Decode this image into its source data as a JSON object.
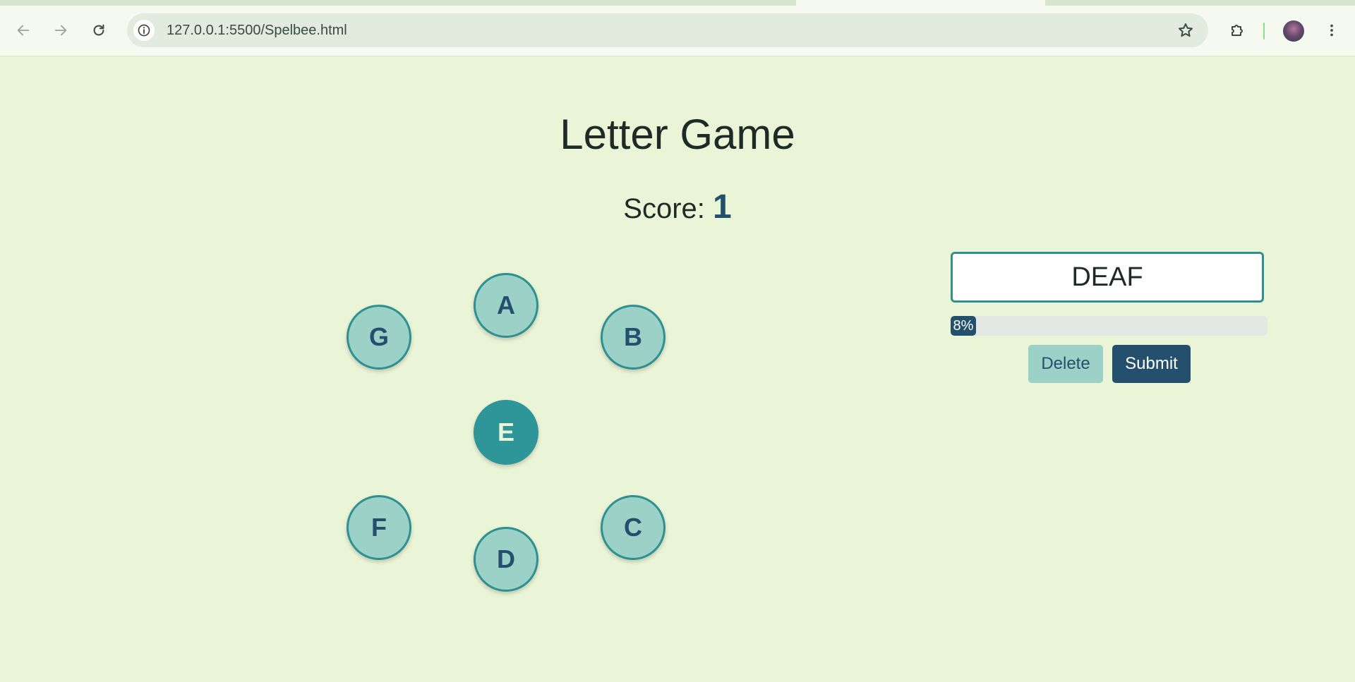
{
  "browser": {
    "url": "127.0.0.1:5500/Spelbee.html",
    "icons": {
      "back": "arrow-left-icon",
      "forward": "arrow-right-icon",
      "reload": "reload-icon",
      "site_info": "info-icon",
      "bookmark": "star-icon",
      "extensions": "puzzle-icon",
      "profile": "avatar",
      "menu": "kebab-menu-icon"
    }
  },
  "game": {
    "title": "Letter Game",
    "score_label": "Score:",
    "score_value": "1",
    "letters": {
      "top": "A",
      "upper_left": "G",
      "upper_right": "B",
      "center": "E",
      "lower_left": "F",
      "lower_right": "C",
      "bottom": "D"
    },
    "current_word": "DEAF",
    "progress_percent": 8,
    "progress_label": "8%",
    "delete_label": "Delete",
    "submit_label": "Submit"
  },
  "colors": {
    "page_background": "#eaf4d7",
    "letter_fill": "#9bd1c6",
    "letter_border": "#2e9090",
    "center_fill": "#2e9598",
    "accent_dark": "#24506e"
  }
}
